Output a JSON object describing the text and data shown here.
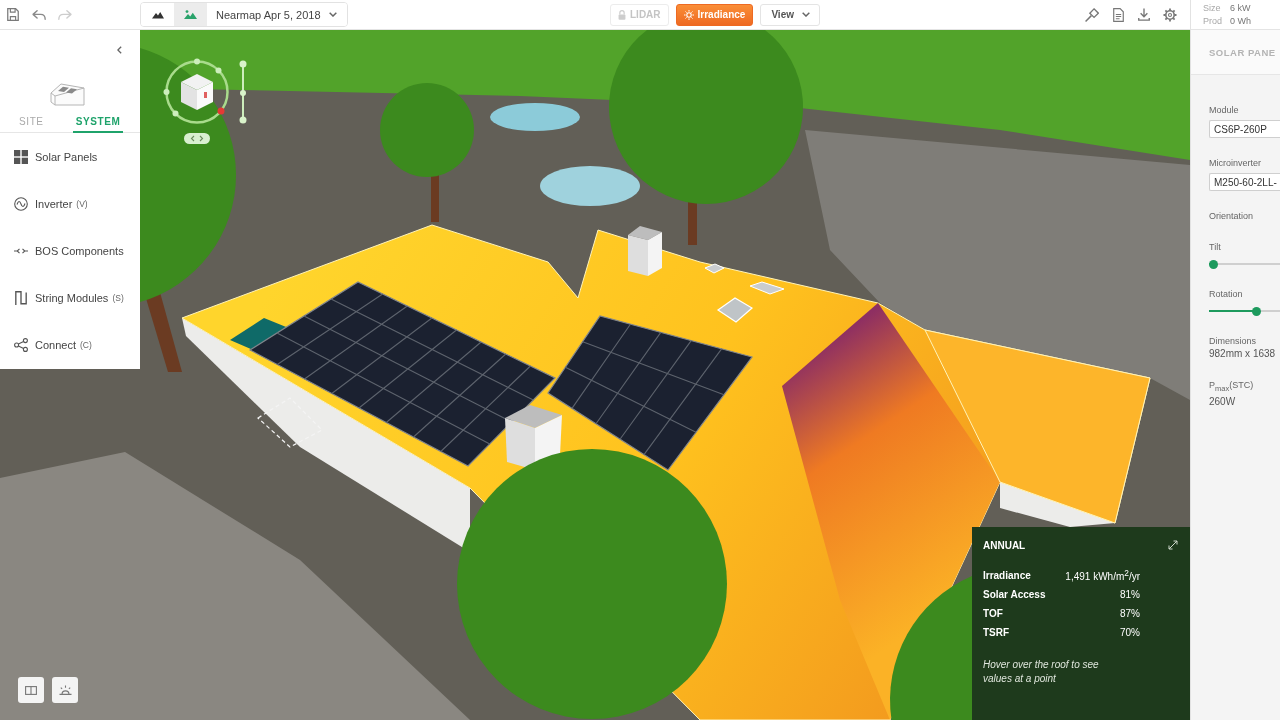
{
  "history": [
    {
      "disabled": false
    },
    {
      "disabled": true
    }
  ],
  "imagery": {
    "modes": [
      {
        "selected": false
      },
      {
        "selected": true
      }
    ],
    "source": "Nearmap Apr 5, 2018"
  },
  "view_modes": [
    {
      "label": "LIDAR",
      "selected": false,
      "disabled": true
    },
    {
      "label": "Irradiance",
      "selected": true,
      "disabled": false
    }
  ],
  "view_menu": {
    "label": "View"
  },
  "stats": [
    {
      "label": "Size",
      "value": "6 kW"
    },
    {
      "label": "Prod",
      "value": "0 Wh"
    }
  ],
  "sidebar": {
    "tabs": [
      {
        "label": "SITE",
        "selected": false
      },
      {
        "label": "SYSTEM",
        "selected": true
      }
    ],
    "items": [
      {
        "label": "Solar Panels"
      },
      {
        "label": "Inverter",
        "shortcut": "(V)"
      },
      {
        "label": "BOS Components"
      },
      {
        "label": "String Modules",
        "shortcut": "(S)"
      },
      {
        "label": "Connect",
        "shortcut": "(C)"
      }
    ]
  },
  "properties": {
    "title": "SOLAR PANE",
    "fields": [
      {
        "kind": "select",
        "label": "Module",
        "value": "CS6P-260P"
      },
      {
        "kind": "select",
        "label": "Microinverter",
        "value": "M250-60-2LL-"
      },
      {
        "kind": "heading",
        "label": "Orientation"
      },
      {
        "kind": "slider",
        "label": "Tilt",
        "level": 0
      },
      {
        "kind": "slider",
        "label": "Rotation",
        "level": 0.69
      },
      {
        "kind": "info",
        "label": "Dimensions",
        "value": "982mm x 1638"
      },
      {
        "kind": "info",
        "label": "P$_{max}$(STC)",
        "value": "260W"
      }
    ]
  },
  "annual": {
    "title": "ANNUAL",
    "rows": [
      {
        "label": "Irradiance",
        "value": "1,491 kWh/m$^{2}$/yr"
      },
      {
        "label": "Solar Access",
        "value": "81%"
      },
      {
        "label": "TOF",
        "value": "87%"
      },
      {
        "label": "TSRF",
        "value": "70%"
      }
    ],
    "hint": "Hover over the roof to see values at a point"
  }
}
